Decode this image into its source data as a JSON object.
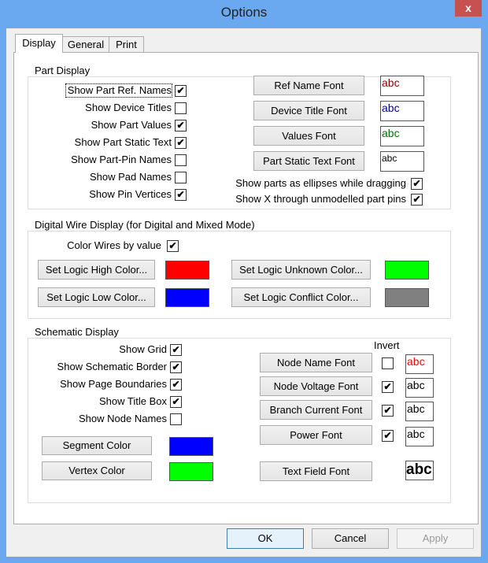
{
  "window": {
    "title": "Options",
    "close": "x"
  },
  "tabs": [
    "Display",
    "General",
    "Print"
  ],
  "part_display": {
    "label": "Part Display",
    "checks": [
      {
        "label": "Show Part Ref. Names",
        "checked": true
      },
      {
        "label": "Show Device Titles",
        "checked": false
      },
      {
        "label": "Show Part Values",
        "checked": true
      },
      {
        "label": "Show Part Static Text",
        "checked": true
      },
      {
        "label": "Show Part-Pin Names",
        "checked": false
      },
      {
        "label": "Show Pad Names",
        "checked": false
      },
      {
        "label": "Show Pin Vertices",
        "checked": true
      }
    ],
    "fonts": [
      {
        "label": "Ref Name Font",
        "sample": "abc",
        "color": "#8b0000"
      },
      {
        "label": "Device Title Font",
        "sample": "abc",
        "color": "#00008b"
      },
      {
        "label": "Values Font",
        "sample": "abc",
        "color": "#007000"
      },
      {
        "label": "Part Static Text Font",
        "sample": "abc",
        "color": "#000000"
      }
    ],
    "right_checks": [
      {
        "label": "Show parts as ellipses while dragging",
        "checked": true
      },
      {
        "label": "Show X through unmodelled part pins",
        "checked": true
      }
    ]
  },
  "digital": {
    "label": "Digital Wire Display (for Digital and Mixed Mode)",
    "color_wires": {
      "label": "Color Wires by value",
      "checked": true
    },
    "buttons": [
      {
        "label": "Set Logic High Color...",
        "color": "#ff0000"
      },
      {
        "label": "Set Logic Low Color...",
        "color": "#0000ff"
      },
      {
        "label": "Set Logic Unknown Color...",
        "color": "#00ff00"
      },
      {
        "label": "Set Logic Conflict Color...",
        "color": "#808080"
      }
    ]
  },
  "schematic": {
    "label": "Schematic Display",
    "checks": [
      {
        "label": "Show Grid",
        "checked": true
      },
      {
        "label": "Show Schematic Border",
        "checked": true
      },
      {
        "label": "Show Page Boundaries",
        "checked": true
      },
      {
        "label": "Show Title Box",
        "checked": true
      },
      {
        "label": "Show Node Names",
        "checked": false
      }
    ],
    "segment": {
      "label": "Segment Color",
      "color": "#0000ff"
    },
    "vertex": {
      "label": "Vertex Color",
      "color": "#00ff00"
    },
    "invert_label": "Invert",
    "fonts": [
      {
        "label": "Node Name Font",
        "invert": false,
        "sample": "abc",
        "color": "#ff0000"
      },
      {
        "label": "Node Voltage Font",
        "invert": true,
        "sample": "abc",
        "color": "#000000"
      },
      {
        "label": "Branch Current Font",
        "invert": true,
        "sample": "abc",
        "color": "#000000"
      },
      {
        "label": "Power Font",
        "invert": true,
        "sample": "abc",
        "color": "#000000"
      }
    ],
    "text_field": {
      "label": "Text Field Font",
      "sample": "abc"
    }
  },
  "footer": {
    "ok": "OK",
    "cancel": "Cancel",
    "apply": "Apply"
  }
}
